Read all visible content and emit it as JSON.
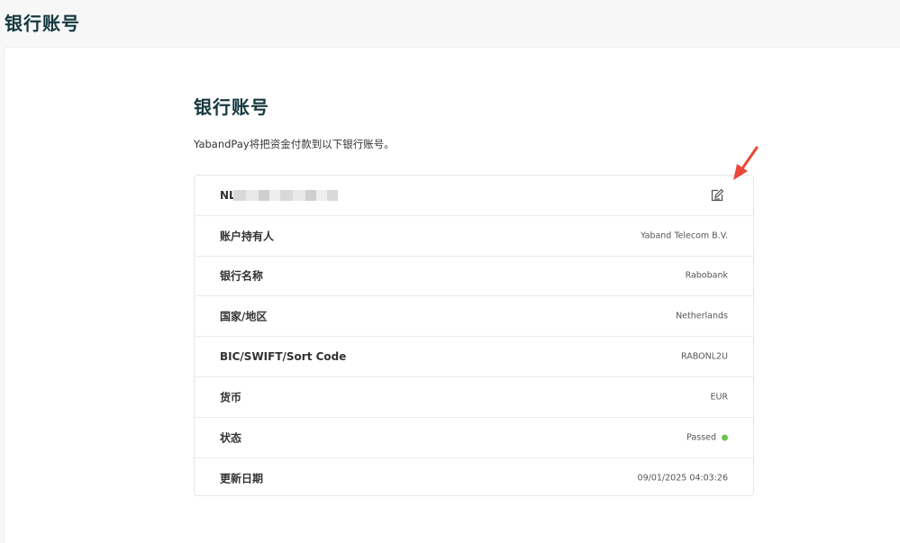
{
  "header": {
    "title": "银行账号"
  },
  "section": {
    "title": "银行账号",
    "description": "YabandPay将把资金付款到以下银行账号。"
  },
  "account": {
    "iban_prefix": "NL",
    "rows": [
      {
        "label": "账户持有人",
        "value": "Yaband Telecom B.V."
      },
      {
        "label": "银行名称",
        "value": "Rabobank"
      },
      {
        "label": "国家/地区",
        "value": "Netherlands"
      },
      {
        "label": "BIC/SWIFT/Sort Code",
        "value": "RABONL2U"
      },
      {
        "label": "货币",
        "value": "EUR"
      },
      {
        "label": "状态",
        "value": "Passed"
      },
      {
        "label": "更新日期",
        "value": "09/01/2025 04:03:26"
      }
    ]
  },
  "colors": {
    "title": "#15383f",
    "status_ok": "#6cc24a",
    "annotation_arrow": "#e8473a"
  },
  "icons": {
    "edit": "edit-icon",
    "annotation": "arrow-annotation-icon"
  }
}
